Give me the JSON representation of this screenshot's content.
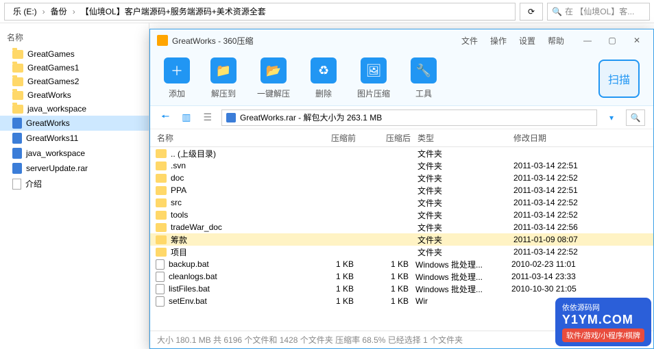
{
  "explorer": {
    "drive": "乐 (E:)",
    "crumbs": [
      "备份",
      "【仙境OL】客户端源码+服务端源码+美术资源全套"
    ],
    "search_placeholder": "在 【仙境OL】客...",
    "sidebar_header": "名称",
    "tree": [
      {
        "label": "GreatGames",
        "type": "folder"
      },
      {
        "label": "GreatGames1",
        "type": "folder"
      },
      {
        "label": "GreatGames2",
        "type": "folder"
      },
      {
        "label": "GreatWorks",
        "type": "folder"
      },
      {
        "label": "java_workspace",
        "type": "folder"
      },
      {
        "label": "GreatWorks",
        "type": "rar",
        "selected": true
      },
      {
        "label": "GreatWorks11",
        "type": "rar"
      },
      {
        "label": "java_workspace",
        "type": "rar"
      },
      {
        "label": "serverUpdate.rar",
        "type": "rar"
      },
      {
        "label": "介绍",
        "type": "txt"
      }
    ]
  },
  "zip": {
    "title": "GreatWorks - 360压缩",
    "menu": [
      "文件",
      "操作",
      "设置",
      "帮助"
    ],
    "tools": [
      {
        "label": "添加",
        "icon": "＋"
      },
      {
        "label": "解压到",
        "icon": "📁"
      },
      {
        "label": "一键解压",
        "icon": "📂"
      },
      {
        "label": "删除",
        "icon": "♻"
      },
      {
        "label": "图片压缩",
        "icon": "🖼"
      },
      {
        "label": "工具",
        "icon": "🔧"
      }
    ],
    "scan_label": "扫描",
    "path_text": "GreatWorks.rar - 解包大小为 263.1 MB",
    "headers": {
      "name": "名称",
      "before": "压缩前",
      "after": "压缩后",
      "type": "类型",
      "date": "修改日期"
    },
    "rows": [
      {
        "name": ".. (上级目录)",
        "before": "",
        "after": "",
        "type": "文件夹",
        "date": "",
        "icon": "folder"
      },
      {
        "name": ".svn",
        "before": "",
        "after": "",
        "type": "文件夹",
        "date": "2011-03-14 22:51",
        "icon": "folder"
      },
      {
        "name": "doc",
        "before": "",
        "after": "",
        "type": "文件夹",
        "date": "2011-03-14 22:52",
        "icon": "folder"
      },
      {
        "name": "PPA",
        "before": "",
        "after": "",
        "type": "文件夹",
        "date": "2011-03-14 22:51",
        "icon": "folder"
      },
      {
        "name": "src",
        "before": "",
        "after": "",
        "type": "文件夹",
        "date": "2011-03-14 22:52",
        "icon": "folder"
      },
      {
        "name": "tools",
        "before": "",
        "after": "",
        "type": "文件夹",
        "date": "2011-03-14 22:52",
        "icon": "folder"
      },
      {
        "name": "tradeWar_doc",
        "before": "",
        "after": "",
        "type": "文件夹",
        "date": "2011-03-14 22:56",
        "icon": "folder"
      },
      {
        "name": "筹款",
        "before": "",
        "after": "",
        "type": "文件夹",
        "date": "2011-01-09 08:07",
        "icon": "folder",
        "hl": true
      },
      {
        "name": "项目",
        "before": "",
        "after": "",
        "type": "文件夹",
        "date": "2011-03-14 22:52",
        "icon": "folder"
      },
      {
        "name": "backup.bat",
        "before": "1 KB",
        "after": "1 KB",
        "type": "Windows 批处理...",
        "date": "2010-02-23 11:01",
        "icon": "bat"
      },
      {
        "name": "cleanlogs.bat",
        "before": "1 KB",
        "after": "1 KB",
        "type": "Windows 批处理...",
        "date": "2011-03-14 23:33",
        "icon": "bat"
      },
      {
        "name": "listFiles.bat",
        "before": "1 KB",
        "after": "1 KB",
        "type": "Windows 批处理...",
        "date": "2010-10-30 21:05",
        "icon": "bat"
      },
      {
        "name": "setEnv.bat",
        "before": "1 KB",
        "after": "1 KB",
        "type": "Wir",
        "date": "",
        "icon": "bat"
      }
    ],
    "status": "大小 180.1 MB 共 6196 个文件和 1428 个文件夹 压缩率 68.5% 已经选择 1 个文件夹"
  },
  "watermark": {
    "line1": "依依源码网",
    "line2": "Y1YM.COM",
    "line3": "软件/游戏/小程序/棋牌"
  }
}
